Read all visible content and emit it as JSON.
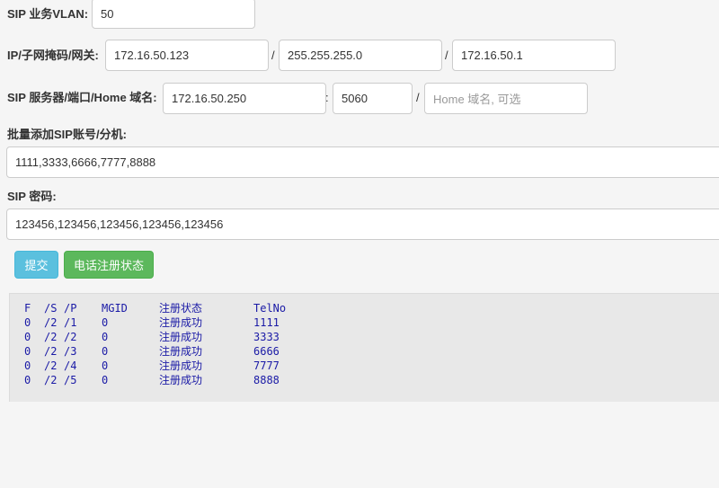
{
  "form": {
    "vlan": {
      "label": "SIP 业务VLAN:",
      "value": "50"
    },
    "ip": {
      "label": "IP/子网掩码/网关:",
      "address": "172.16.50.123",
      "mask": "255.255.255.0",
      "gateway": "172.16.50.1",
      "sep": "/"
    },
    "server": {
      "label": "SIP 服务器/端口/Home 域名:",
      "address": "172.16.50.250",
      "port": "5060",
      "domain_placeholder": "Home 域名, 可选",
      "colon": ":",
      "sep": "/"
    },
    "accounts": {
      "label": "批量添加SIP账号/分机:",
      "value": "1111,3333,6666,7777,8888"
    },
    "password": {
      "label": "SIP 密码:",
      "value": "123456,123456,123456,123456,123456"
    }
  },
  "buttons": {
    "submit": "提交",
    "status": "电话注册状态"
  },
  "status_table": {
    "headers": {
      "f": "F",
      "s": "/S",
      "p": "/P",
      "mgid": "MGID",
      "state": "注册状态",
      "telno": "TelNo"
    },
    "rows": [
      {
        "f": "0",
        "s": "/2",
        "p": "/1",
        "mgid": "0",
        "state": "注册成功",
        "telno": "1111"
      },
      {
        "f": "0",
        "s": "/2",
        "p": "/2",
        "mgid": "0",
        "state": "注册成功",
        "telno": "3333"
      },
      {
        "f": "0",
        "s": "/2",
        "p": "/3",
        "mgid": "0",
        "state": "注册成功",
        "telno": "6666"
      },
      {
        "f": "0",
        "s": "/2",
        "p": "/4",
        "mgid": "0",
        "state": "注册成功",
        "telno": "7777"
      },
      {
        "f": "0",
        "s": "/2",
        "p": "/5",
        "mgid": "0",
        "state": "注册成功",
        "telno": "8888"
      }
    ]
  }
}
